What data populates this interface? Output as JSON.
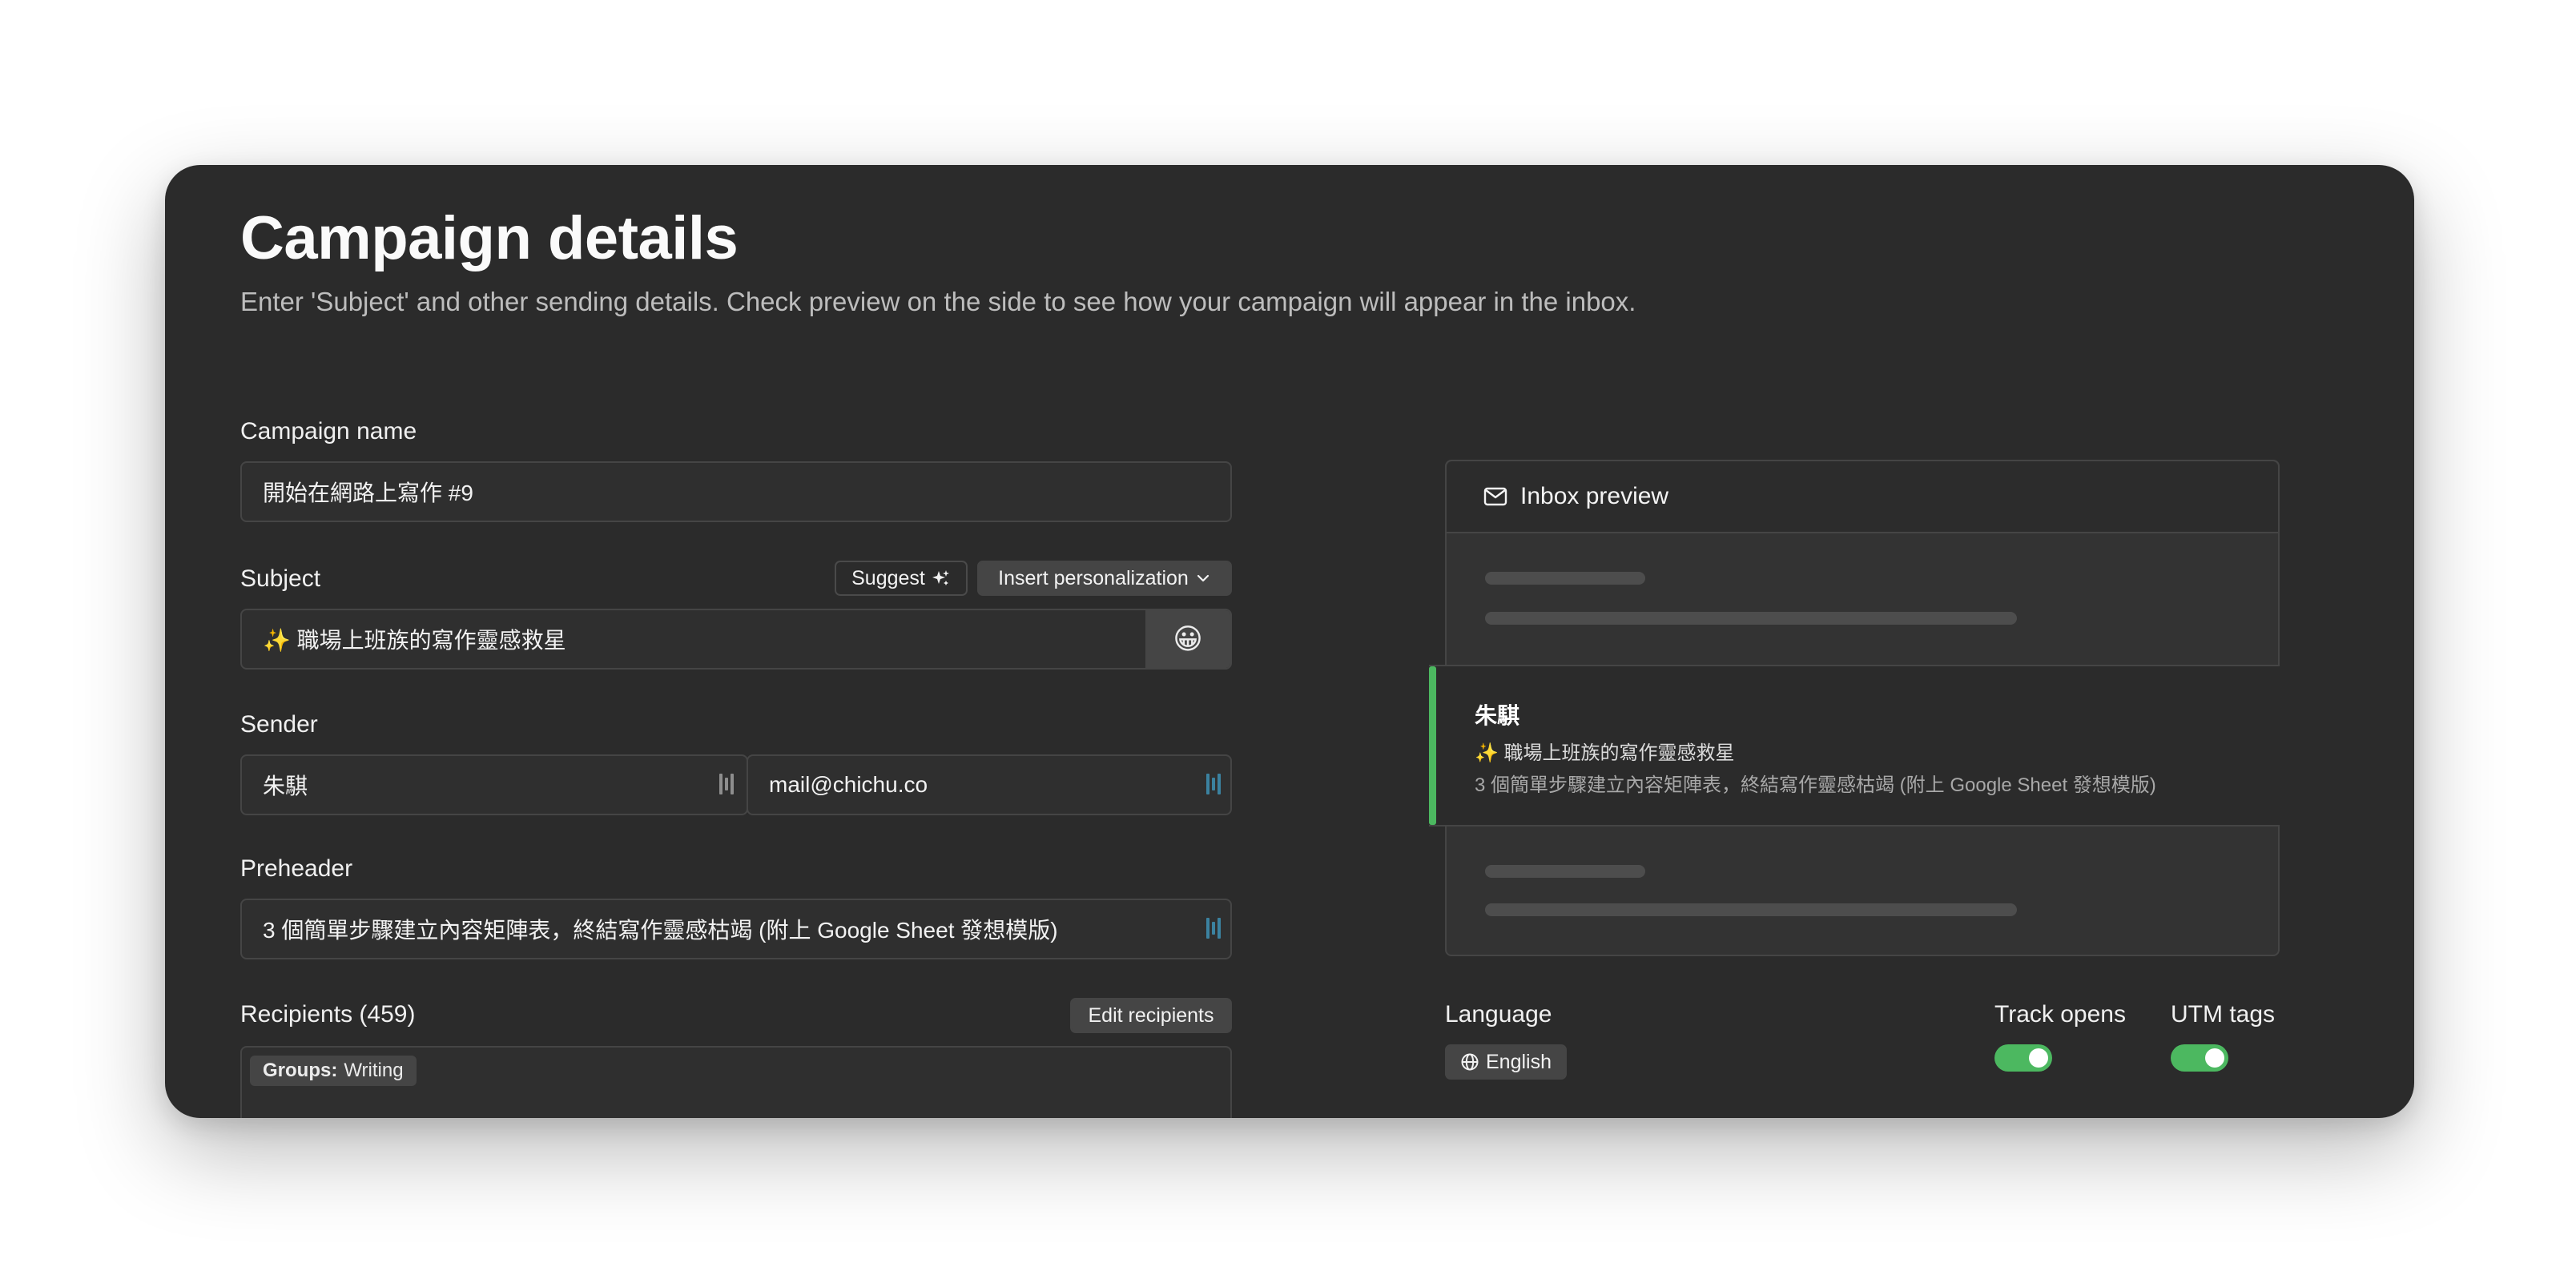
{
  "header": {
    "title": "Campaign details",
    "subtitle": "Enter 'Subject' and other sending details. Check preview on the side to see how your campaign will appear in the inbox."
  },
  "campaign_name": {
    "label": "Campaign name",
    "value": "開始在網路上寫作 #9"
  },
  "subject": {
    "label": "Subject",
    "suggest_label": "Suggest",
    "insert_personalization_label": "Insert personalization",
    "value": "✨ 職場上班族的寫作靈感救星",
    "emoji": "😀"
  },
  "sender": {
    "label": "Sender",
    "name_value": "朱騏",
    "email_value": "mail@chichu.co"
  },
  "preheader": {
    "label": "Preheader",
    "value": "3 個簡單步驟建立內容矩陣表，終結寫作靈感枯竭 (附上 Google Sheet 發想模版)"
  },
  "recipients": {
    "label": "Recipients (459)",
    "edit_label": "Edit recipients",
    "group_key": "Groups:",
    "group_value": "Writing"
  },
  "inbox_preview": {
    "title": "Inbox preview",
    "mail": {
      "from": "朱騏",
      "subject": "✨ 職場上班族的寫作靈感救星",
      "preheader": "3 個簡單步驟建立內容矩陣表，終結寫作靈感枯竭 (附上 Google Sheet 發想模版)"
    }
  },
  "language": {
    "label": "Language",
    "value": "English"
  },
  "track_opens": {
    "label": "Track opens",
    "enabled": true
  },
  "utm_tags": {
    "label": "UTM tags",
    "enabled": true
  },
  "colors": {
    "accent": "#4cb860",
    "card_bg": "#2b2b2b",
    "merge_icon": "#3b82a0"
  }
}
